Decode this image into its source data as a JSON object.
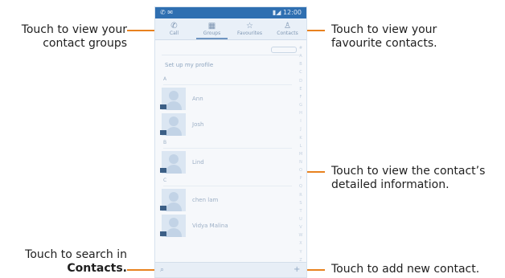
{
  "phone": {
    "status_left": "✆ ✉",
    "status_right": "▮◢ 12:00",
    "tabs": [
      {
        "icon": "phone-icon",
        "glyph": "✆",
        "label": "Call"
      },
      {
        "icon": "groups-icon",
        "glyph": "▦",
        "label": "Groups"
      },
      {
        "icon": "favourites-icon",
        "glyph": "☆",
        "label": "Favourites"
      },
      {
        "icon": "contacts-icon",
        "glyph": "♙",
        "label": "Contacts"
      }
    ],
    "setup_profile": "Set up my profile",
    "sections": [
      "A",
      "B",
      "C"
    ],
    "contacts": [
      "Ann",
      "Josh",
      "Lind",
      "chen lam",
      "Vidya Malina"
    ],
    "alphabet": [
      "#",
      "A",
      "B",
      "C",
      "D",
      "E",
      "F",
      "G",
      "H",
      "I",
      "J",
      "K",
      "L",
      "M",
      "N",
      "O",
      "P",
      "Q",
      "R",
      "S",
      "T",
      "U",
      "V",
      "W",
      "X",
      "Y",
      "Z"
    ],
    "search_glyph": "⌕",
    "add_glyph": "+"
  },
  "callouts": {
    "groups_line1": "Touch to view your",
    "groups_line2": "contact groups",
    "favourites_line1": "Touch to view your",
    "favourites_line2": "favourite contacts.",
    "detail_line1": "Touch to view the contact’s",
    "detail_line2": "detailed information.",
    "search_line1": "Touch to search in",
    "search_line2": "Contacts.",
    "add_line": "Touch to add new contact."
  },
  "colors": {
    "leader": "#e8821f",
    "accent": "#2f6fb1"
  }
}
